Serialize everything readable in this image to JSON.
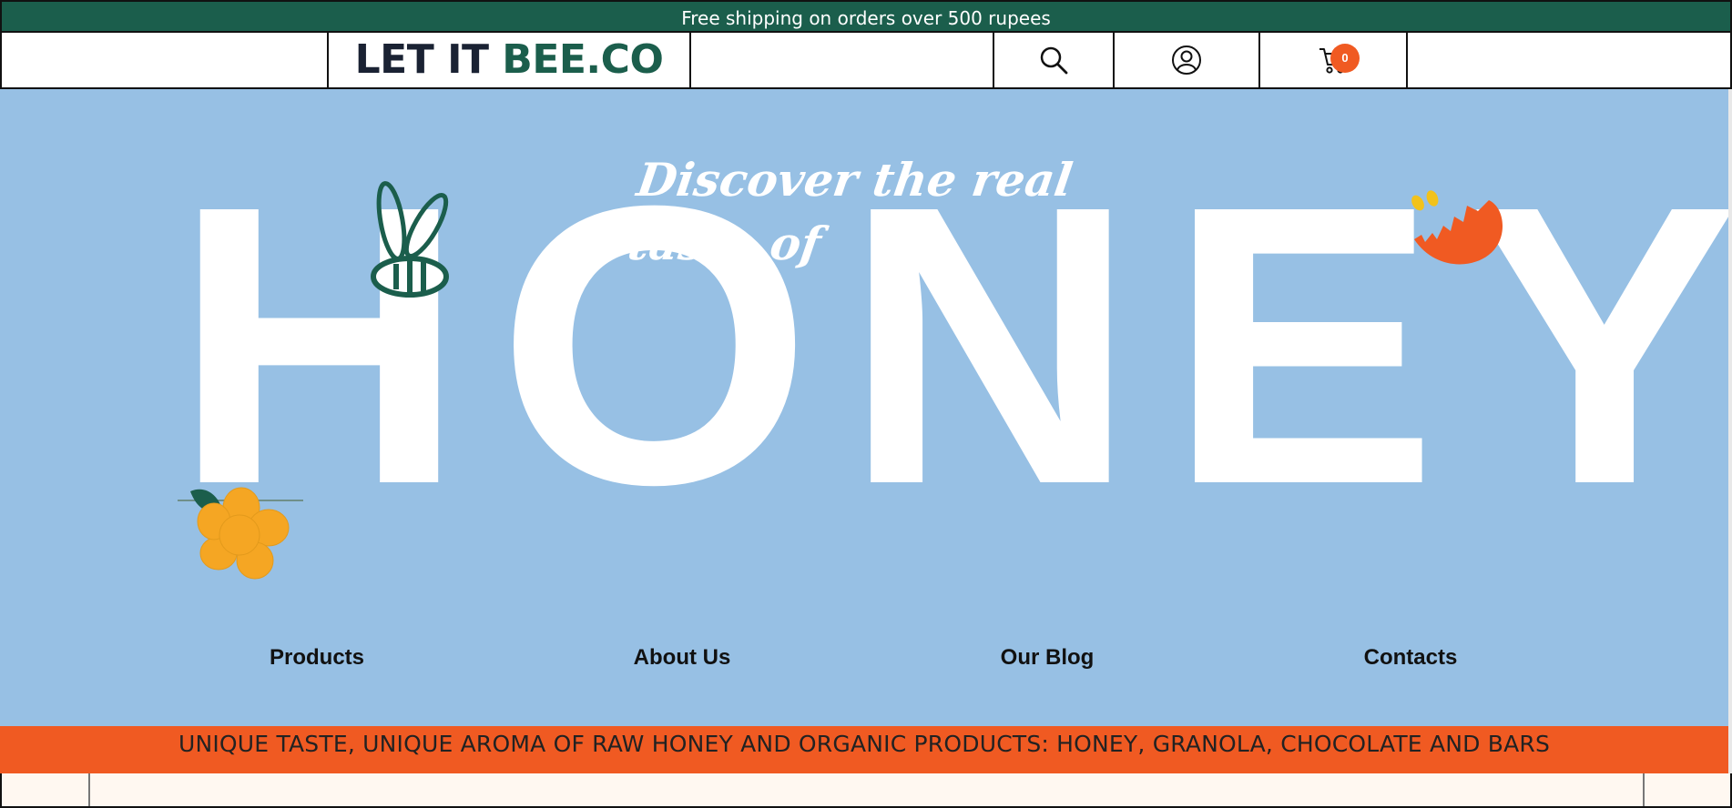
{
  "announcement": "Free shipping on orders over 500 rupees",
  "header": {
    "logo_part1": "LET IT ",
    "logo_part2": "BEE.CO",
    "cart_count": "0",
    "icons": [
      "search-icon",
      "user-icon",
      "cart-icon"
    ]
  },
  "hero": {
    "tagline": "Discover the real taste of",
    "headline": "HONEY"
  },
  "nav": {
    "items": [
      {
        "label": "Products"
      },
      {
        "label": "About Us"
      },
      {
        "label": "Our Blog"
      },
      {
        "label": "Contacts"
      }
    ]
  },
  "banner": "UNIQUE TASTE, UNIQUE AROMA OF RAW HONEY AND ORGANIC PRODUCTS: HONEY, GRANOLA, CHOCOLATE AND BARS",
  "colors": {
    "brand_green": "#1b5e4c",
    "hero_blue": "#97c0e4",
    "accent_orange": "#f05a22",
    "flower_yellow": "#f5a623"
  }
}
